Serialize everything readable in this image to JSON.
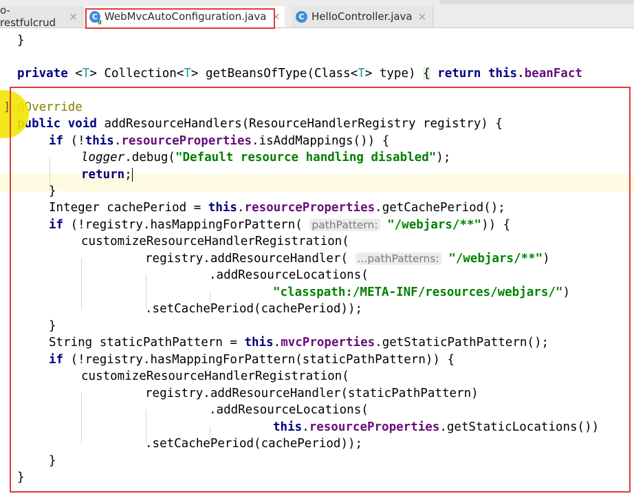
{
  "tabs": [
    {
      "label": "o-restfulcrud",
      "active": false
    },
    {
      "label": "WebMvcAutoConfiguration.java",
      "active": true,
      "icon": "class-icon"
    },
    {
      "label": "HelloController.java",
      "active": false,
      "icon": "class-icon"
    }
  ],
  "close_glyph": "×",
  "icon_letter": "C",
  "code": {
    "l1": "}",
    "l2_private": "private",
    "l2_a": " <",
    "l2_T1": "T",
    "l2_b": "> Collection<",
    "l2_T2": "T",
    "l2_c": "> getBeansOfType(Class<",
    "l2_T3": "T",
    "l2_d": "> type) ",
    "l2_brace": "{",
    "l2_return": "return",
    "l2_this": "this",
    "l2_tail": ".beanFact",
    "l3_ann": "@Override",
    "l4_kw": "public void",
    "l4_rest": " addResourceHandlers(ResourceHandlerRegistry registry) {",
    "l5_if": "if",
    "l5_a": " (!",
    "l5_this": "this",
    "l5_dot": ".",
    "l5_fld": "resourceProperties",
    "l5_rest": ".isAddMappings()) {",
    "l6_logger": "logger",
    "l6_mid": ".debug(",
    "l6_str": "\"Default resource handling disabled\"",
    "l6_end": ");",
    "l7_return": "return",
    "l7_end": ";",
    "l8": "}",
    "l9_a": "Integer cachePeriod = ",
    "l9_this": "this",
    "l9_dot": ".",
    "l9_fld": "resourceProperties",
    "l9_rest": ".getCachePeriod();",
    "l10_if": "if",
    "l10_a": " (!registry.hasMappingForPattern( ",
    "l10_hint": "pathPattern:",
    "l10_str": "\"/webjars/**\"",
    "l10_end": ")) {",
    "l11": "customizeResourceHandlerRegistration(",
    "l12_a": "registry.addResourceHandler( ",
    "l12_hint": "...pathPatterns:",
    "l12_str": "\"/webjars/**\"",
    "l12_end": ")",
    "l13": ".addResourceLocations(",
    "l14_str": "\"classpath:/META-INF/resources/webjars/\"",
    "l14_end": ")",
    "l15": ".setCachePeriod(cachePeriod));",
    "l16": "}",
    "l17_a": "String staticPathPattern = ",
    "l17_this": "this",
    "l17_dot": ".",
    "l17_fld": "mvcProperties",
    "l17_rest": ".getStaticPathPattern();",
    "l18_if": "if",
    "l18_rest": " (!registry.hasMappingForPattern(staticPathPattern)) {",
    "l19": "customizeResourceHandlerRegistration(",
    "l20": "registry.addResourceHandler(staticPathPattern)",
    "l21": ".addResourceLocations(",
    "l22_this": "this",
    "l22_dot": ".",
    "l22_fld": "resourceProperties",
    "l22_rest": ".getStaticLocations())",
    "l23": ".setCachePeriod(cachePeriod));",
    "l24": "}",
    "l25": "}"
  },
  "gutter_bracket": "]",
  "colors": {
    "keyword": "#000080",
    "field": "#660e7a",
    "string": "#008000",
    "annotation": "#808000",
    "highlight_box": "#e0393b"
  }
}
